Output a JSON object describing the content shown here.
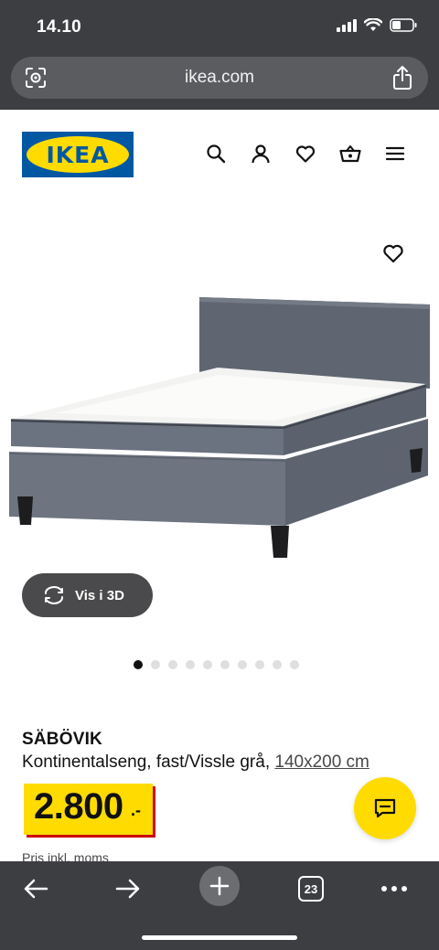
{
  "status": {
    "time": "14.10"
  },
  "browser": {
    "url": "ikea.com",
    "tabs_count": "23"
  },
  "header": {
    "logo_text": "IKEA",
    "icons": [
      "search-icon",
      "profile-icon",
      "heart-icon",
      "basket-icon",
      "menu-icon"
    ]
  },
  "gallery": {
    "view3d_label": "Vis i 3D",
    "image_count": 10,
    "active_index": 0
  },
  "product": {
    "name": "SÄBÖVIK",
    "description": "Kontinentalseng, fast/Vissle grå,",
    "size": "140x200 cm",
    "price": "2.800",
    "price_suffix": ".-",
    "price_note": "Pris inkl. moms"
  },
  "colors": {
    "ikea_blue": "#0058a3",
    "ikea_yellow": "#ffdb00",
    "price_red": "#cc0008",
    "chrome": "#3c3e42"
  }
}
